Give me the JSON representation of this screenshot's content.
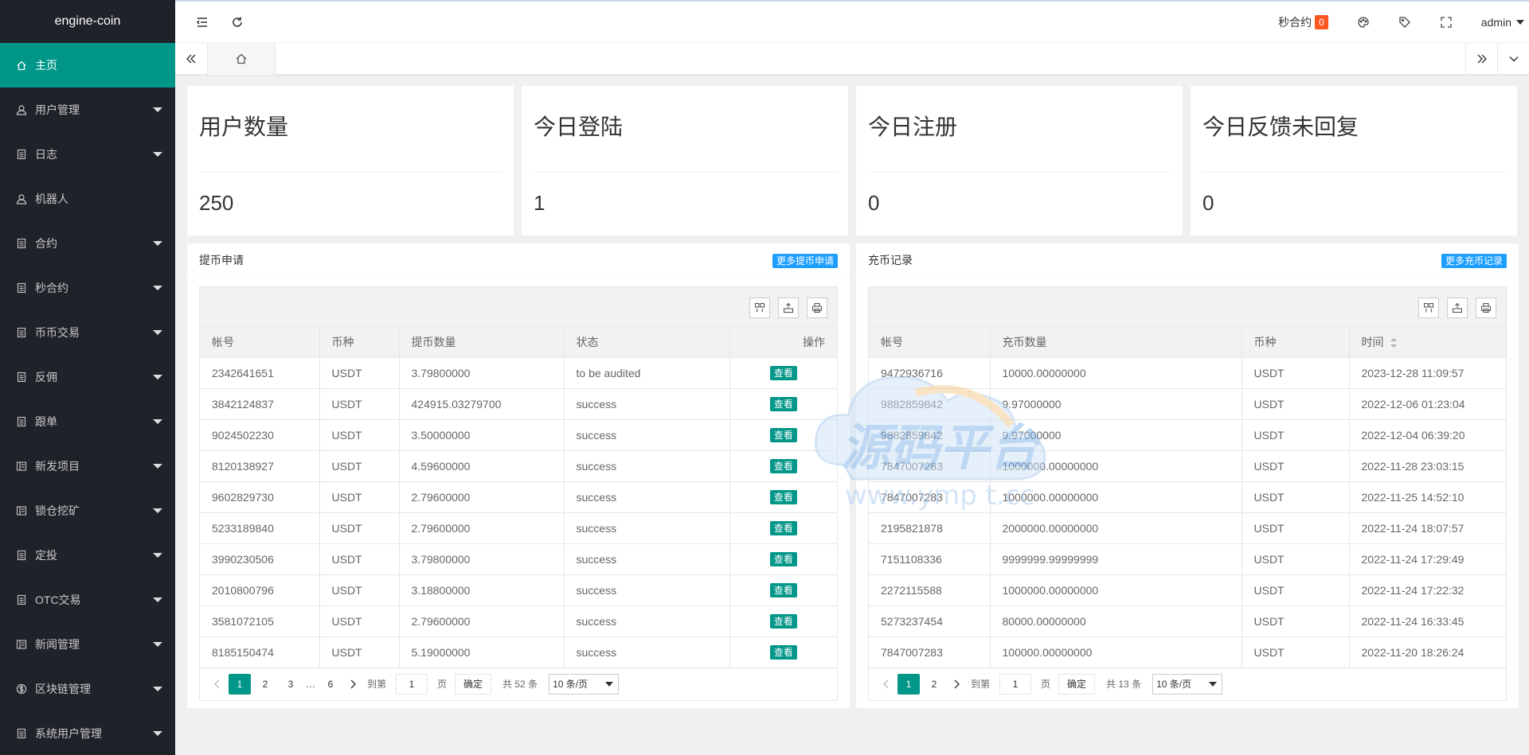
{
  "app": {
    "logo": "engine-coin"
  },
  "sidebar": {
    "items": [
      {
        "label": "主页",
        "icon": "home-icon",
        "active": true,
        "expandable": false
      },
      {
        "label": "用户管理",
        "icon": "user-icon",
        "expandable": true
      },
      {
        "label": "日志",
        "icon": "file-icon",
        "expandable": true
      },
      {
        "label": "机器人",
        "icon": "user-icon",
        "expandable": false
      },
      {
        "label": "合约",
        "icon": "file-icon",
        "expandable": true
      },
      {
        "label": "秒合约",
        "icon": "file-icon",
        "expandable": true
      },
      {
        "label": "币币交易",
        "icon": "file-icon",
        "expandable": true
      },
      {
        "label": "反佣",
        "icon": "file-icon",
        "expandable": true
      },
      {
        "label": "跟单",
        "icon": "file-icon",
        "expandable": true
      },
      {
        "label": "新发项目",
        "icon": "list-icon",
        "expandable": true
      },
      {
        "label": "锁仓挖矿",
        "icon": "list-icon",
        "expandable": true
      },
      {
        "label": "定投",
        "icon": "file-icon",
        "expandable": true
      },
      {
        "label": "OTC交易",
        "icon": "file-icon",
        "expandable": true
      },
      {
        "label": "新闻管理",
        "icon": "list-icon",
        "expandable": true
      },
      {
        "label": "区块链管理",
        "icon": "dollar-icon",
        "expandable": true
      },
      {
        "label": "系统用户管理",
        "icon": "file-icon",
        "expandable": true
      }
    ]
  },
  "header": {
    "notice_label": "秒合约",
    "notice_count": "0",
    "user": "admin"
  },
  "stats": [
    {
      "title": "用户数量",
      "value": "250"
    },
    {
      "title": "今日登陆",
      "value": "1"
    },
    {
      "title": "今日注册",
      "value": "0"
    },
    {
      "title": "今日反馈未回复",
      "value": "0"
    }
  ],
  "withdraw": {
    "title": "提币申请",
    "more": "更多提币申请",
    "columns": [
      "帐号",
      "币种",
      "提币数量",
      "状态",
      "操作"
    ],
    "action_label": "查看",
    "rows": [
      [
        "2342641651",
        "USDT",
        "3.79800000",
        "to be audited"
      ],
      [
        "3842124837",
        "USDT",
        "424915.03279700",
        "success"
      ],
      [
        "9024502230",
        "USDT",
        "3.50000000",
        "success"
      ],
      [
        "8120138927",
        "USDT",
        "4.59600000",
        "success"
      ],
      [
        "9602829730",
        "USDT",
        "2.79600000",
        "success"
      ],
      [
        "5233189840",
        "USDT",
        "2.79600000",
        "success"
      ],
      [
        "3990230506",
        "USDT",
        "3.79800000",
        "success"
      ],
      [
        "2010800796",
        "USDT",
        "3.18800000",
        "success"
      ],
      [
        "3581072105",
        "USDT",
        "2.79600000",
        "success"
      ],
      [
        "8185150474",
        "USDT",
        "5.19000000",
        "success"
      ]
    ],
    "pager": {
      "pages": [
        "1",
        "2",
        "3",
        "…",
        "6"
      ],
      "goto_label": "到第",
      "goto_value": "1",
      "page_unit": "页",
      "confirm": "确定",
      "total": "共 52 条",
      "per_page": "10 条/页"
    }
  },
  "deposit": {
    "title": "充币记录",
    "more": "更多充币记录",
    "columns": [
      "帐号",
      "充币数量",
      "币种",
      "时间"
    ],
    "rows": [
      [
        "9472936716",
        "10000.00000000",
        "USDT",
        "2023-12-28 11:09:57"
      ],
      [
        "9882859842",
        "9.97000000",
        "USDT",
        "2022-12-06 01:23:04"
      ],
      [
        "9882859842",
        "9.97000000",
        "USDT",
        "2022-12-04 06:39:20"
      ],
      [
        "7847007283",
        "1000000.00000000",
        "USDT",
        "2022-11-28 23:03:15"
      ],
      [
        "7847007283",
        "1000000.00000000",
        "USDT",
        "2022-11-25 14:52:10"
      ],
      [
        "2195821878",
        "2000000.00000000",
        "USDT",
        "2022-11-24 18:07:57"
      ],
      [
        "7151108336",
        "9999999.99999999",
        "USDT",
        "2022-11-24 17:29:49"
      ],
      [
        "2272115588",
        "1000000.00000000",
        "USDT",
        "2022-11-24 17:22:32"
      ],
      [
        "5273237454",
        "80000.00000000",
        "USDT",
        "2022-11-24 16:33:45"
      ],
      [
        "7847007283",
        "100000.00000000",
        "USDT",
        "2022-11-20 18:26:24"
      ]
    ],
    "pager": {
      "pages": [
        "1",
        "2"
      ],
      "goto_label": "到第",
      "goto_value": "1",
      "page_unit": "页",
      "confirm": "确定",
      "total": "共 13 条",
      "per_page": "10 条/页"
    }
  },
  "watermark": {
    "text_cn": "源码平台",
    "text_url": "www.ymp t.cc"
  },
  "colors": {
    "primary": "#009688",
    "sidebar": "#20222a",
    "blue": "#1e9fff",
    "badge": "#ff5722"
  }
}
